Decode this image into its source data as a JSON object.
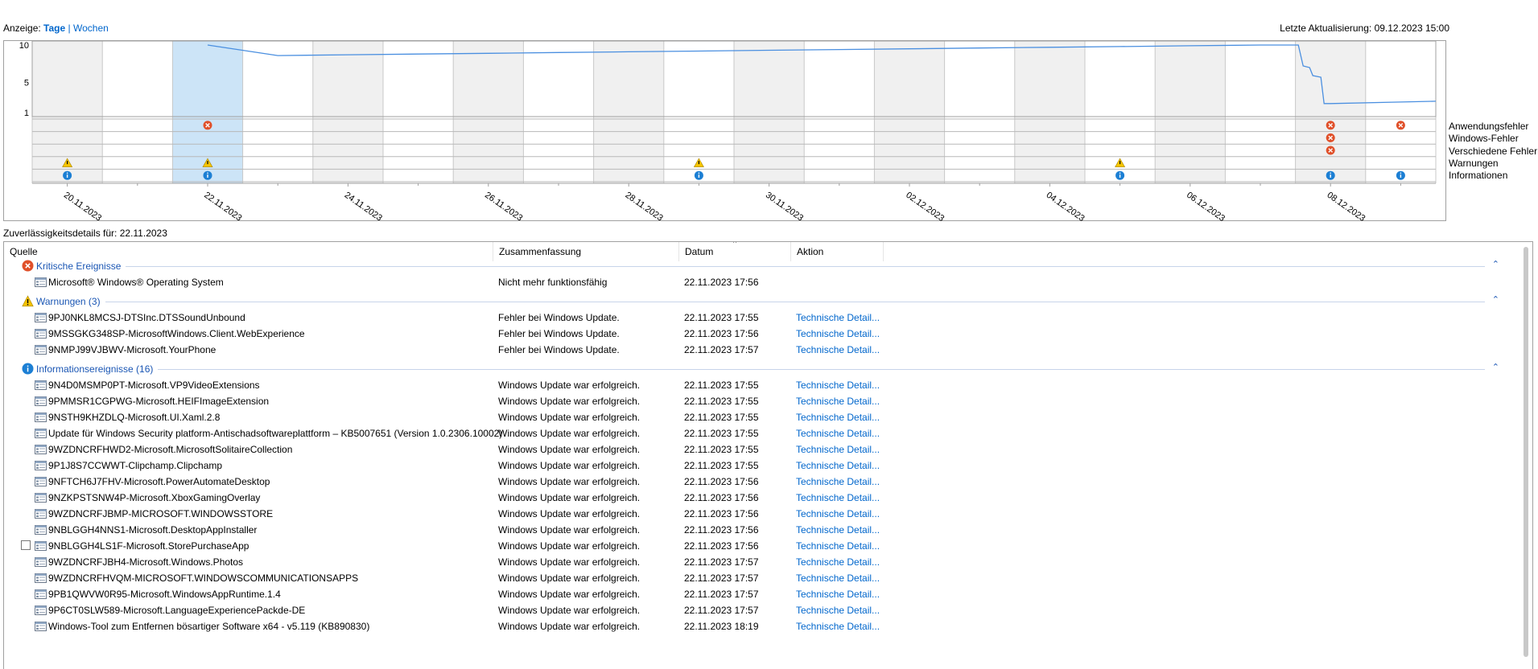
{
  "header": {
    "view_label": "Anzeige:",
    "days": "Tage",
    "separator": "|",
    "weeks": "Wochen",
    "last_update": "Letzte Aktualisierung: 09.12.2023 15:00"
  },
  "chart_data": {
    "type": "line",
    "yticks": [
      "10",
      "5",
      "1"
    ],
    "ylim": [
      1,
      10
    ],
    "x": [
      "20.11.2023",
      "21.11.2023",
      "22.11.2023",
      "23.11.2023",
      "24.11.2023",
      "25.11.2023",
      "26.11.2023",
      "27.11.2023",
      "28.11.2023",
      "29.11.2023",
      "30.11.2023",
      "01.12.2023",
      "02.12.2023",
      "03.12.2023",
      "04.12.2023",
      "05.12.2023",
      "06.12.2023",
      "07.12.2023",
      "08.12.2023",
      "09.12.2023"
    ],
    "date_labels": [
      "20.11.2023",
      "22.11.2023",
      "24.11.2023",
      "26.11.2023",
      "28.11.2023",
      "30.11.2023",
      "02.12.2023",
      "04.12.2023",
      "06.12.2023",
      "08.12.2023"
    ],
    "series": [
      {
        "values": [
          null,
          null,
          10,
          8.6,
          8.7,
          8.8,
          8.9,
          9.0,
          9.1,
          9.2,
          9.3,
          9.4,
          9.5,
          9.6,
          9.7,
          9.8,
          9.9,
          10,
          2.2,
          2.4
        ]
      }
    ],
    "selected_category": "22.11.2023",
    "event_rows": [
      "Anwendungsfehler",
      "Windows-Fehler",
      "Verschiedene Fehler",
      "Warnungen",
      "Informationen"
    ],
    "events": [
      {
        "day": 2,
        "row": 0,
        "kind": "error"
      },
      {
        "day": 18,
        "row": 0,
        "kind": "error"
      },
      {
        "day": 19,
        "row": 0,
        "kind": "error"
      },
      {
        "day": 18,
        "row": 1,
        "kind": "error"
      },
      {
        "day": 18,
        "row": 2,
        "kind": "error"
      },
      {
        "day": 0,
        "row": 3,
        "kind": "warning"
      },
      {
        "day": 2,
        "row": 3,
        "kind": "warning"
      },
      {
        "day": 9,
        "row": 3,
        "kind": "warning"
      },
      {
        "day": 15,
        "row": 3,
        "kind": "warning"
      },
      {
        "day": 0,
        "row": 4,
        "kind": "info"
      },
      {
        "day": 2,
        "row": 4,
        "kind": "info"
      },
      {
        "day": 9,
        "row": 4,
        "kind": "info"
      },
      {
        "day": 15,
        "row": 4,
        "kind": "info"
      },
      {
        "day": 18,
        "row": 4,
        "kind": "info"
      },
      {
        "day": 19,
        "row": 4,
        "kind": "info"
      }
    ],
    "colors": {
      "line": "#4a8fe0",
      "shade": "#f0f0f0",
      "selected": "#cce4f7",
      "error": "#e0502a",
      "warning": "#f5c400",
      "info": "#1c7fd4"
    }
  },
  "legend": [
    "Anwendungsfehler",
    "Windows-Fehler",
    "Verschiedene Fehler",
    "Warnungen",
    "Informationen"
  ],
  "details_title": "Zuverlässigkeitsdetails für: 22.11.2023",
  "columns": [
    "Quelle",
    "Zusammenfassung",
    "Datum",
    "Aktion"
  ],
  "groups": [
    {
      "label": "Kritische Ereignisse",
      "icon": "error-icon",
      "rows": [
        {
          "source": "Microsoft® Windows® Operating System",
          "summary": "Nicht mehr funktionsfähig",
          "date": "22.11.2023 17:56",
          "action": ""
        }
      ]
    },
    {
      "label": "Warnungen (3)",
      "icon": "warning-icon",
      "rows": [
        {
          "source": "9PJ0NKL8MCSJ-DTSInc.DTSSoundUnbound",
          "summary": "Fehler bei Windows Update.",
          "date": "22.11.2023 17:55",
          "action": "Technische Detail..."
        },
        {
          "source": "9MSSGKG348SP-MicrosoftWindows.Client.WebExperience",
          "summary": "Fehler bei Windows Update.",
          "date": "22.11.2023 17:56",
          "action": "Technische Detail..."
        },
        {
          "source": "9NMPJ99VJBWV-Microsoft.YourPhone",
          "summary": "Fehler bei Windows Update.",
          "date": "22.11.2023 17:57",
          "action": "Technische Detail..."
        }
      ]
    },
    {
      "label": "Informationsereignisse (16)",
      "icon": "info-icon",
      "rows": [
        {
          "source": "9N4D0MSMP0PT-Microsoft.VP9VideoExtensions",
          "summary": "Windows Update war erfolgreich.",
          "date": "22.11.2023 17:55",
          "action": "Technische Detail..."
        },
        {
          "source": "9PMMSR1CGPWG-Microsoft.HEIFImageExtension",
          "summary": "Windows Update war erfolgreich.",
          "date": "22.11.2023 17:55",
          "action": "Technische Detail..."
        },
        {
          "source": "9NSTH9KHZDLQ-Microsoft.UI.Xaml.2.8",
          "summary": "Windows Update war erfolgreich.",
          "date": "22.11.2023 17:55",
          "action": "Technische Detail..."
        },
        {
          "source": "Update für Windows Security platform-Antischadsoftwareplattform – KB5007651 (Version 1.0.2306.10002)",
          "summary": "Windows Update war erfolgreich.",
          "date": "22.11.2023 17:55",
          "action": "Technische Detail..."
        },
        {
          "source": "9WZDNCRFHWD2-Microsoft.MicrosoftSolitaireCollection",
          "summary": "Windows Update war erfolgreich.",
          "date": "22.11.2023 17:55",
          "action": "Technische Detail..."
        },
        {
          "source": "9P1J8S7CCWWT-Clipchamp.Clipchamp",
          "summary": "Windows Update war erfolgreich.",
          "date": "22.11.2023 17:55",
          "action": "Technische Detail..."
        },
        {
          "source": "9NFTCH6J7FHV-Microsoft.PowerAutomateDesktop",
          "summary": "Windows Update war erfolgreich.",
          "date": "22.11.2023 17:56",
          "action": "Technische Detail..."
        },
        {
          "source": "9NZKPSTSNW4P-Microsoft.XboxGamingOverlay",
          "summary": "Windows Update war erfolgreich.",
          "date": "22.11.2023 17:56",
          "action": "Technische Detail..."
        },
        {
          "source": "9WZDNCRFJBMP-MICROSOFT.WINDOWSSTORE",
          "summary": "Windows Update war erfolgreich.",
          "date": "22.11.2023 17:56",
          "action": "Technische Detail..."
        },
        {
          "source": "9NBLGGH4NNS1-Microsoft.DesktopAppInstaller",
          "summary": "Windows Update war erfolgreich.",
          "date": "22.11.2023 17:56",
          "action": "Technische Detail..."
        },
        {
          "source": "9NBLGGH4LS1F-Microsoft.StorePurchaseApp",
          "summary": "Windows Update war erfolgreich.",
          "date": "22.11.2023 17:56",
          "action": "Technische Detail...",
          "checkbox": true
        },
        {
          "source": "9WZDNCRFJBH4-Microsoft.Windows.Photos",
          "summary": "Windows Update war erfolgreich.",
          "date": "22.11.2023 17:57",
          "action": "Technische Detail..."
        },
        {
          "source": "9WZDNCRFHVQM-MICROSOFT.WINDOWSCOMMUNICATIONSAPPS",
          "summary": "Windows Update war erfolgreich.",
          "date": "22.11.2023 17:57",
          "action": "Technische Detail..."
        },
        {
          "source": "9PB1QWVW0R95-Microsoft.WindowsAppRuntime.1.4",
          "summary": "Windows Update war erfolgreich.",
          "date": "22.11.2023 17:57",
          "action": "Technische Detail..."
        },
        {
          "source": "9P6CT0SLW589-Microsoft.LanguageExperiencePackde-DE",
          "summary": "Windows Update war erfolgreich.",
          "date": "22.11.2023 17:57",
          "action": "Technische Detail..."
        },
        {
          "source": "Windows-Tool zum Entfernen bösartiger Software x64 - v5.119 (KB890830)",
          "summary": "Windows Update war erfolgreich.",
          "date": "22.11.2023 18:19",
          "action": "Technische Detail..."
        }
      ]
    }
  ]
}
